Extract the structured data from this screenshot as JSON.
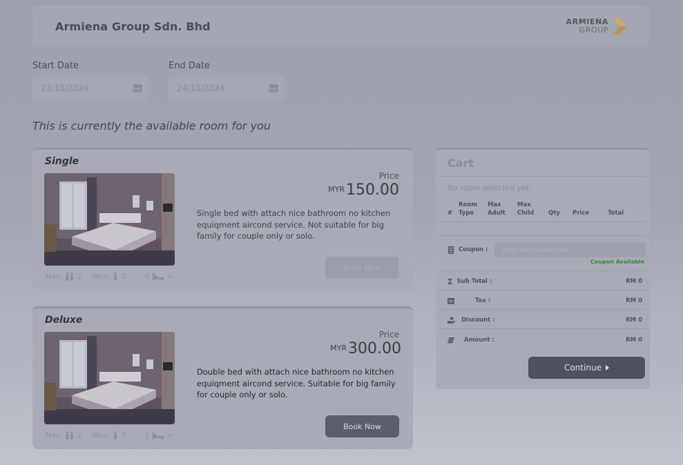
{
  "header": {
    "company": "Armiena Group Sdn. Bhd",
    "logo_line1": "ARMIENA",
    "logo_line2": "GROUP"
  },
  "dates": {
    "start_label": "Start Date",
    "start_value": "23/10/2024",
    "end_label": "End Date",
    "end_value": "24/10/2024"
  },
  "subtitle": "This is currently the available room for you",
  "rooms": [
    {
      "name": "Single",
      "price_label": "Price",
      "currency": "MYR",
      "price": "150.00",
      "description": "Single bed with  attach nice bathroom no kitchen equiqment aircond service. Not suitable for big family for couple only or solo.",
      "button": "Book Now",
      "max_label_1": "Max:",
      "max_adult": "2",
      "max_label_2": "Max:",
      "max_child": "2",
      "minus": "-",
      "qty": "0",
      "plus": "+"
    },
    {
      "name": "Deluxe",
      "price_label": "Price",
      "currency": "MYR",
      "price": "300.00",
      "description": "Double bed with  attach nice bathroom no kitchen equiqment aircond service. Suitable for big family for couple only or solo.",
      "button": "Book Now",
      "max_label_1": "Max:",
      "max_adult": "2",
      "max_label_2": "Max:",
      "max_child": "2",
      "minus": "-",
      "qty": "1",
      "plus": "+"
    }
  ],
  "cart": {
    "title": "Cart",
    "empty": "No room selected yet",
    "columns": [
      "#",
      "Room\nType",
      "Max\nAdult",
      "Max\nChild",
      "Qty",
      "Price",
      "Total"
    ],
    "coupon_label": "Coupon :",
    "coupon_placeholder": "Enter Your Coupon here",
    "coupon_available": "Coupon Available",
    "subtotal_label": "Sub Total :",
    "subtotal_value": "RM 0",
    "tax_label": "Tax :",
    "tax_value": "RM 0",
    "discount_label": "Discount :",
    "discount_value": "RM 0",
    "amount_label": "Amount :",
    "amount_value": "RM 0",
    "continue": "Continue"
  },
  "colors": {
    "accent_logo": "#c9a266",
    "coupon_available": "#2e8b3c"
  }
}
